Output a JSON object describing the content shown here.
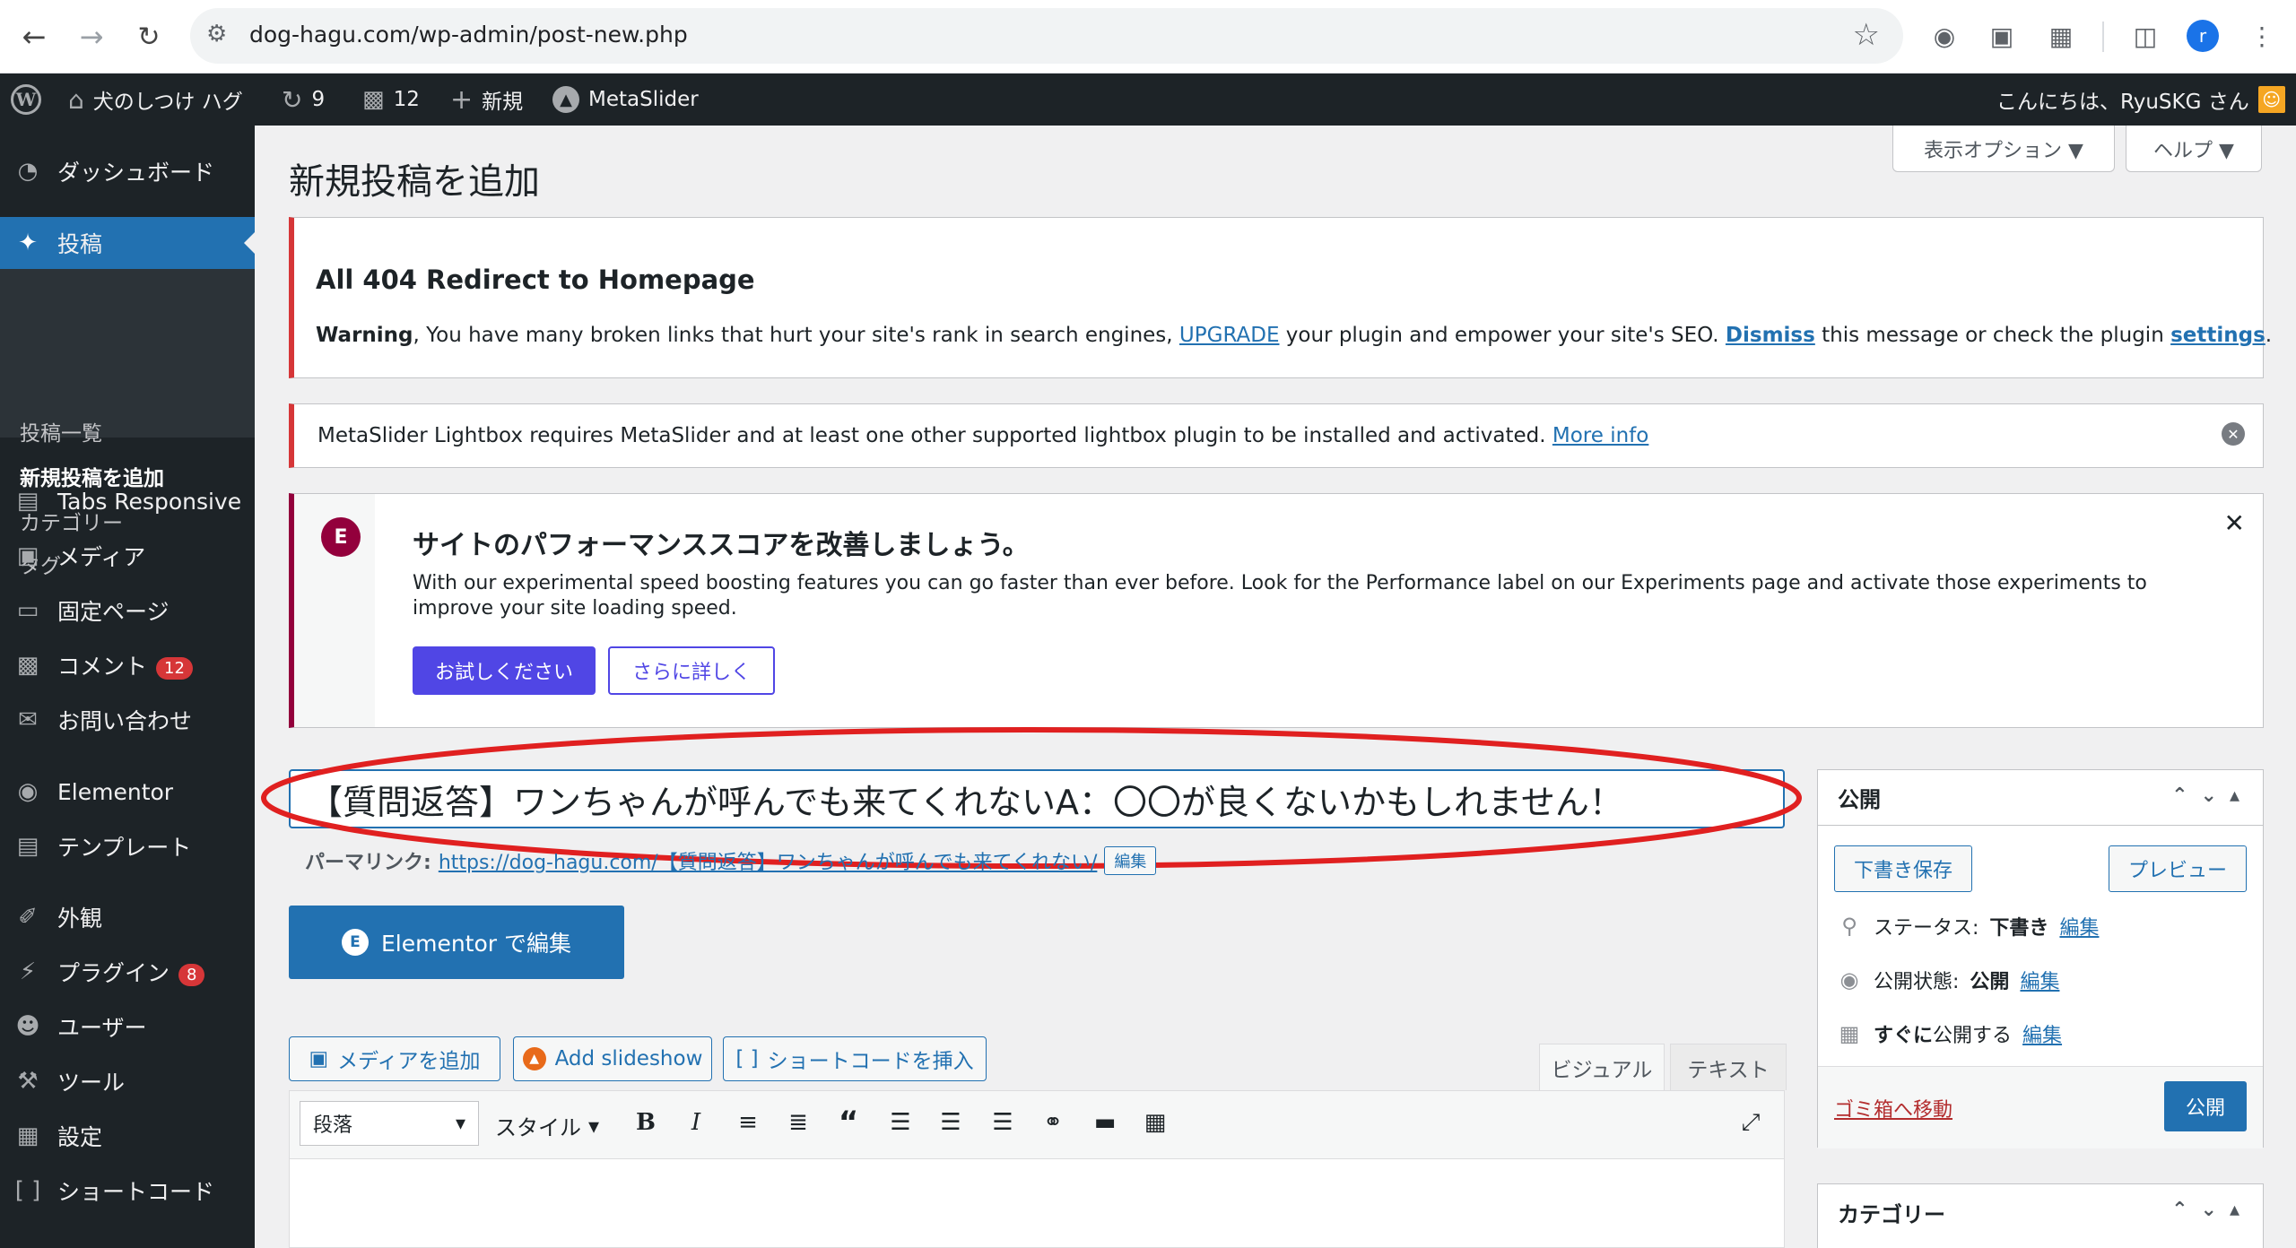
{
  "browser": {
    "url": "dog-hagu.com/wp-admin/post-new.php",
    "avatar_letter": "r"
  },
  "adminbar": {
    "site_name": "犬のしつけ ハグ",
    "updates_count": "9",
    "comments_count": "12",
    "new_label": "新規",
    "metaslider_label": "MetaSlider",
    "greeting": "こんにちは、RyuSKG さん"
  },
  "sidebar": {
    "dashboard": "ダッシュボード",
    "posts": "投稿",
    "posts_sub": [
      "投稿一覧",
      "新規投稿を追加",
      "カテゴリー",
      "タグ"
    ],
    "items": [
      {
        "label": "Tabs Responsive",
        "icon": "folder-icon"
      },
      {
        "label": "メディア",
        "icon": "media-icon"
      },
      {
        "label": "固定ページ",
        "icon": "page-icon"
      },
      {
        "label": "コメント",
        "icon": "comment-icon",
        "badge": "12"
      },
      {
        "label": "お問い合わせ",
        "icon": "mail-icon"
      },
      {
        "label": "Elementor",
        "icon": "elementor-icon"
      },
      {
        "label": "テンプレート",
        "icon": "folder-icon"
      },
      {
        "label": "外観",
        "icon": "brush-icon"
      },
      {
        "label": "プラグイン",
        "icon": "plugin-icon",
        "badge": "8"
      },
      {
        "label": "ユーザー",
        "icon": "user-icon"
      },
      {
        "label": "ツール",
        "icon": "wrench-icon"
      },
      {
        "label": "設定",
        "icon": "settings-icon"
      },
      {
        "label": "ショートコード",
        "icon": "brackets-icon"
      }
    ]
  },
  "screen_options": {
    "display": "表示オプション ▼",
    "help": "ヘルプ ▼"
  },
  "page_title": "新規投稿を追加",
  "notice_404": {
    "title": "All 404 Redirect to Homepage",
    "warning": "Warning",
    "text1": ", You have many broken links that hurt your site's rank in search engines, ",
    "upgrade": "UPGRADE",
    "text2": " your plugin and empower your site's SEO.  ",
    "dismiss": "Dismiss",
    "text3": " this message or check the plugin ",
    "settings": "settings",
    "text4": "."
  },
  "notice_metaslider": {
    "text": "MetaSlider Lightbox requires MetaSlider and at least one other supported lightbox plugin to be installed and activated. ",
    "more_info": "More info"
  },
  "notice_elementor": {
    "title": "サイトのパフォーマンススコアを改善しましょう。",
    "text": "With our experimental speed boosting features you can go faster than ever before. Look for the Performance label on our Experiments page and activate those experiments to improve your site loading speed.",
    "try_button": "お試しください",
    "learn_button": "さらに詳しく"
  },
  "editor": {
    "title_value": "【質問返答】ワンちゃんが呼んでも来てくれないA：〇〇が良くないかもしれません！",
    "permalink_label": "パーマリンク:",
    "permalink_url": "https://dog-hagu.com/【質問返答】ワンちゃんが呼んでも来てくれない/",
    "permalink_edit": "編集",
    "elementor_button": "Elementor で編集",
    "add_media": "メディアを追加",
    "add_slideshow": "Add slideshow",
    "insert_shortcode": "ショートコードを挿入",
    "tab_visual": "ビジュアル",
    "tab_text": "テキスト",
    "format_select": "段落",
    "style_select": "スタイル"
  },
  "publish_box": {
    "title": "公開",
    "save_draft": "下書き保存",
    "preview": "プレビュー",
    "status_label": "ステータス:",
    "status_value": "下書き",
    "visibility_label": "公開状態:",
    "visibility_value": "公開",
    "schedule_label": "すぐに",
    "schedule_suffix": "公開する",
    "edit": "編集",
    "trash": "ゴミ箱へ移動",
    "publish_button": "公開"
  },
  "category_box": {
    "title": "カテゴリー"
  },
  "colors": {
    "admin_dark": "#1d2327",
    "wp_blue": "#2271b1",
    "elementor_accent": "#5046e5",
    "notice_red": "#d63638",
    "annotation_red": "#e02020"
  }
}
